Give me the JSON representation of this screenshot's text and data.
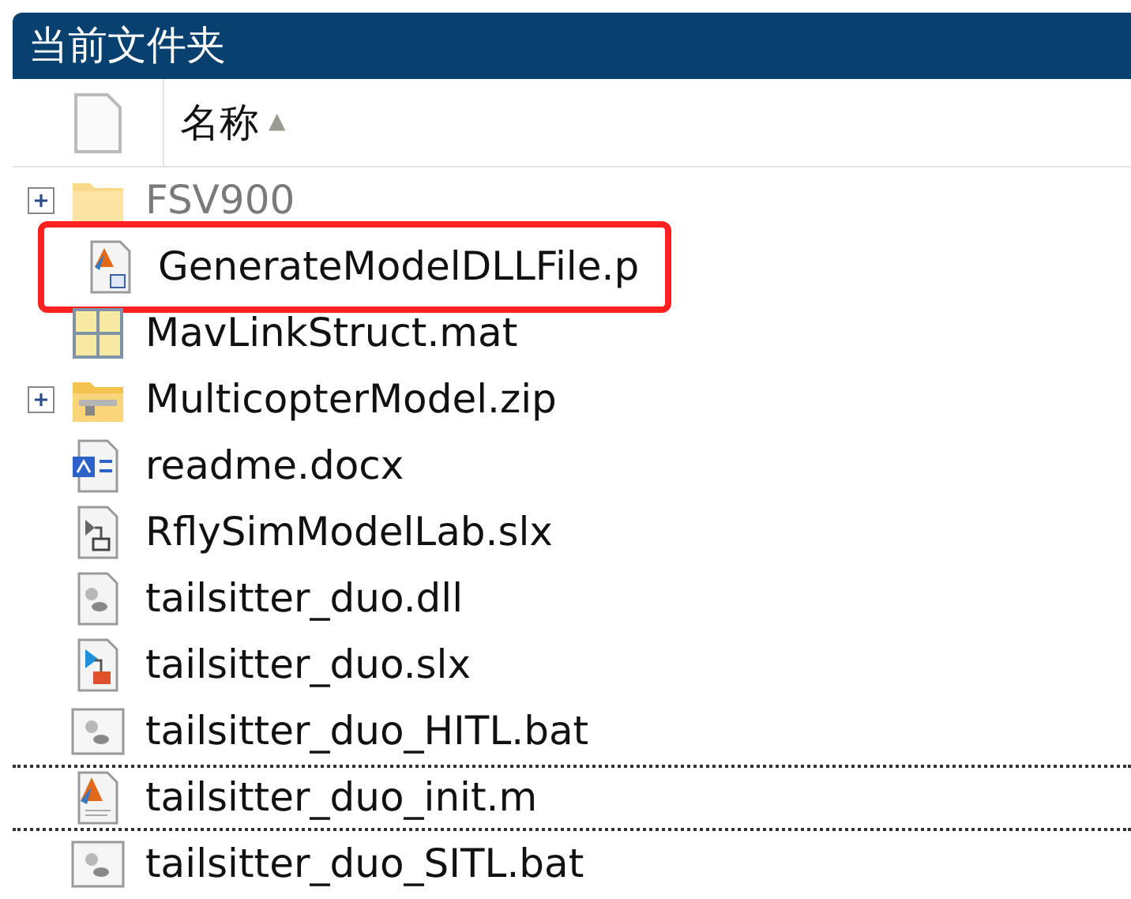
{
  "panel": {
    "title": "当前文件夹"
  },
  "header": {
    "column": "名称",
    "sort_indicator": "▲"
  },
  "files": [
    {
      "name": "FSV900",
      "kind": "folder",
      "expandable": true,
      "greyed": true,
      "highlighted": false,
      "focused": false
    },
    {
      "name": "GenerateModelDLLFile.p",
      "kind": "pcode",
      "expandable": false,
      "greyed": false,
      "highlighted": true,
      "focused": false
    },
    {
      "name": "MavLinkStruct.mat",
      "kind": "mat",
      "expandable": false,
      "greyed": false,
      "highlighted": false,
      "focused": false
    },
    {
      "name": "MulticopterModel.zip",
      "kind": "zip",
      "expandable": true,
      "greyed": false,
      "highlighted": false,
      "focused": false
    },
    {
      "name": "readme.docx",
      "kind": "docx",
      "expandable": false,
      "greyed": false,
      "highlighted": false,
      "focused": false
    },
    {
      "name": "RflySimModelLab.slx",
      "kind": "slx",
      "expandable": false,
      "greyed": false,
      "highlighted": false,
      "focused": false
    },
    {
      "name": "tailsitter_duo.dll",
      "kind": "dll",
      "expandable": false,
      "greyed": false,
      "highlighted": false,
      "focused": false
    },
    {
      "name": "tailsitter_duo.slx",
      "kind": "slx2",
      "expandable": false,
      "greyed": false,
      "highlighted": false,
      "focused": false
    },
    {
      "name": "tailsitter_duo_HITL.bat",
      "kind": "bat",
      "expandable": false,
      "greyed": false,
      "highlighted": false,
      "focused": false
    },
    {
      "name": "tailsitter_duo_init.m",
      "kind": "m",
      "expandable": false,
      "greyed": false,
      "highlighted": false,
      "focused": true
    },
    {
      "name": "tailsitter_duo_SITL.bat",
      "kind": "bat",
      "expandable": false,
      "greyed": false,
      "highlighted": false,
      "focused": false
    }
  ]
}
